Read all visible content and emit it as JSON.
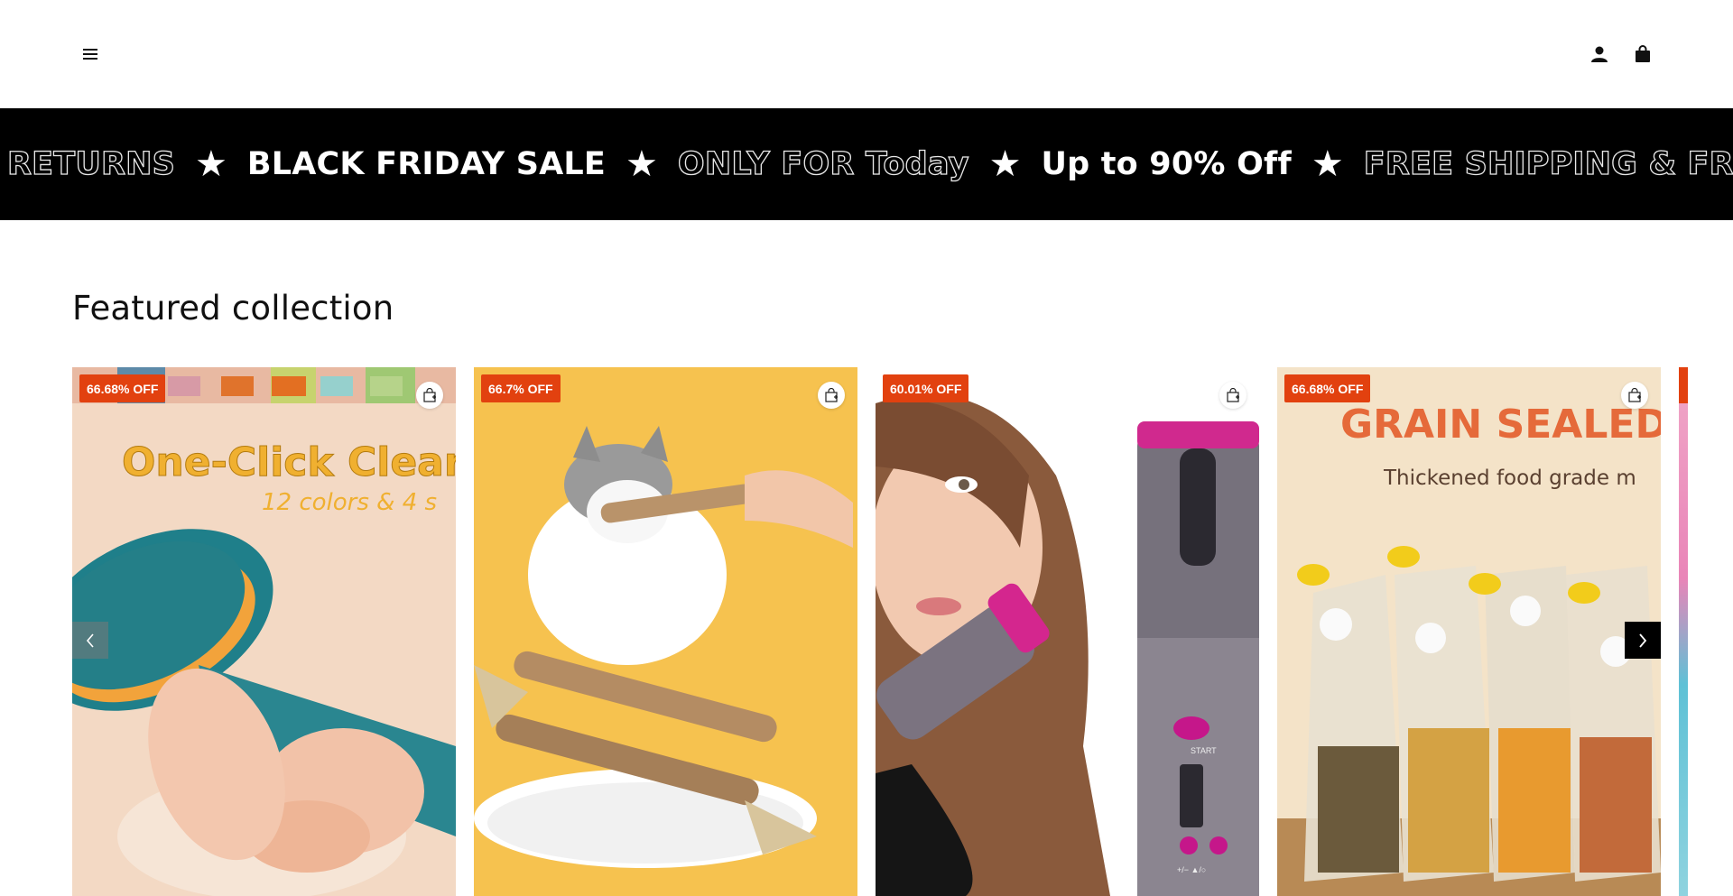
{
  "header": {
    "menu_icon": "hamburger-icon",
    "account_icon": "user-icon",
    "cart_icon": "shopping-bag-icon"
  },
  "marquee": {
    "items": [
      {
        "text": "RETURNS",
        "style": "outline"
      },
      {
        "text": "BLACK FRIDAY SALE",
        "style": "solid"
      },
      {
        "text": "ONLY FOR Today",
        "style": "outline"
      },
      {
        "text": "Up to 90% Off",
        "style": "solid"
      },
      {
        "text": "FREE SHIPPING & FREE RETURNS",
        "style": "outline"
      }
    ],
    "separator": "★"
  },
  "featured": {
    "title": "Featured collection",
    "products": [
      {
        "badge": "66.68% OFF",
        "image_text_1": "One-Click Clear",
        "image_text_2": "12 colors & 4 s",
        "bg": "#f3d9c4"
      },
      {
        "badge": "66.7% OFF",
        "bg": "#f5c04a"
      },
      {
        "badge": "60.01% OFF",
        "device_label_start": "START",
        "device_label_buttons": "+/−    ▲/○",
        "bg": "#ffffff"
      },
      {
        "badge": "66.68% OFF",
        "image_text_1": "GRAIN SEALED",
        "image_text_2": "Thickened food grade m",
        "bg": "#f3e0c4"
      },
      {
        "badge": "",
        "bg": "#e9a9c9"
      }
    ]
  },
  "colors": {
    "badge": "#e2410f",
    "marquee_bg": "#000000"
  }
}
